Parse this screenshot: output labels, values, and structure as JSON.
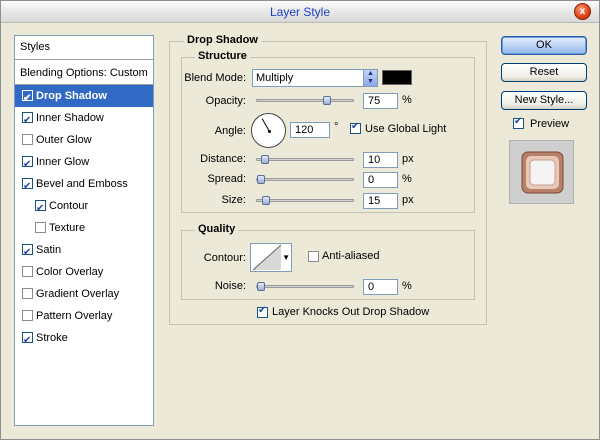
{
  "window": {
    "title": "Layer Style",
    "close_glyph": "x"
  },
  "styles_panel": {
    "header": "Styles",
    "blending_options": "Blending Options: Custom",
    "items": [
      {
        "label": "Drop Shadow",
        "checked": true,
        "selected": true
      },
      {
        "label": "Inner Shadow",
        "checked": true
      },
      {
        "label": "Outer Glow",
        "checked": false
      },
      {
        "label": "Inner Glow",
        "checked": true
      },
      {
        "label": "Bevel and Emboss",
        "checked": true
      },
      {
        "label": "Contour",
        "checked": true,
        "indent": true
      },
      {
        "label": "Texture",
        "checked": false,
        "indent": true
      },
      {
        "label": "Satin",
        "checked": true
      },
      {
        "label": "Color Overlay",
        "checked": false
      },
      {
        "label": "Gradient Overlay",
        "checked": false
      },
      {
        "label": "Pattern Overlay",
        "checked": false
      },
      {
        "label": "Stroke",
        "checked": true
      }
    ]
  },
  "drop_shadow": {
    "title": "Drop Shadow",
    "structure": {
      "title": "Structure",
      "blend_mode_label": "Blend Mode:",
      "blend_mode_value": "Multiply",
      "color": "#000000",
      "opacity_label": "Opacity:",
      "opacity_value": "75",
      "opacity_unit": "%",
      "opacity_fraction": 0.75,
      "angle_label": "Angle:",
      "angle_value": "120",
      "angle_unit": "°",
      "angle_degrees": 120,
      "use_global_light_label": "Use Global Light",
      "use_global_light_checked": true,
      "distance_label": "Distance:",
      "distance_value": "10",
      "distance_unit": "px",
      "distance_fraction": 0.04,
      "spread_label": "Spread:",
      "spread_value": "0",
      "spread_unit": "%",
      "spread_fraction": 0.0,
      "size_label": "Size:",
      "size_value": "15",
      "size_unit": "px",
      "size_fraction": 0.06
    },
    "quality": {
      "title": "Quality",
      "contour_label": "Contour:",
      "anti_aliased_label": "Anti-aliased",
      "anti_aliased_checked": false,
      "noise_label": "Noise:",
      "noise_value": "0",
      "noise_unit": "%",
      "noise_fraction": 0.0
    },
    "knockout_label": "Layer Knocks Out Drop Shadow",
    "knockout_checked": true
  },
  "buttons": {
    "ok": "OK",
    "reset": "Reset",
    "new_style": "New Style...",
    "preview_label": "Preview",
    "preview_checked": true
  },
  "colors": {
    "selection": "#316AC5",
    "dialog_bg": "#ECE9D8",
    "title_text": "#1E3FC9"
  }
}
